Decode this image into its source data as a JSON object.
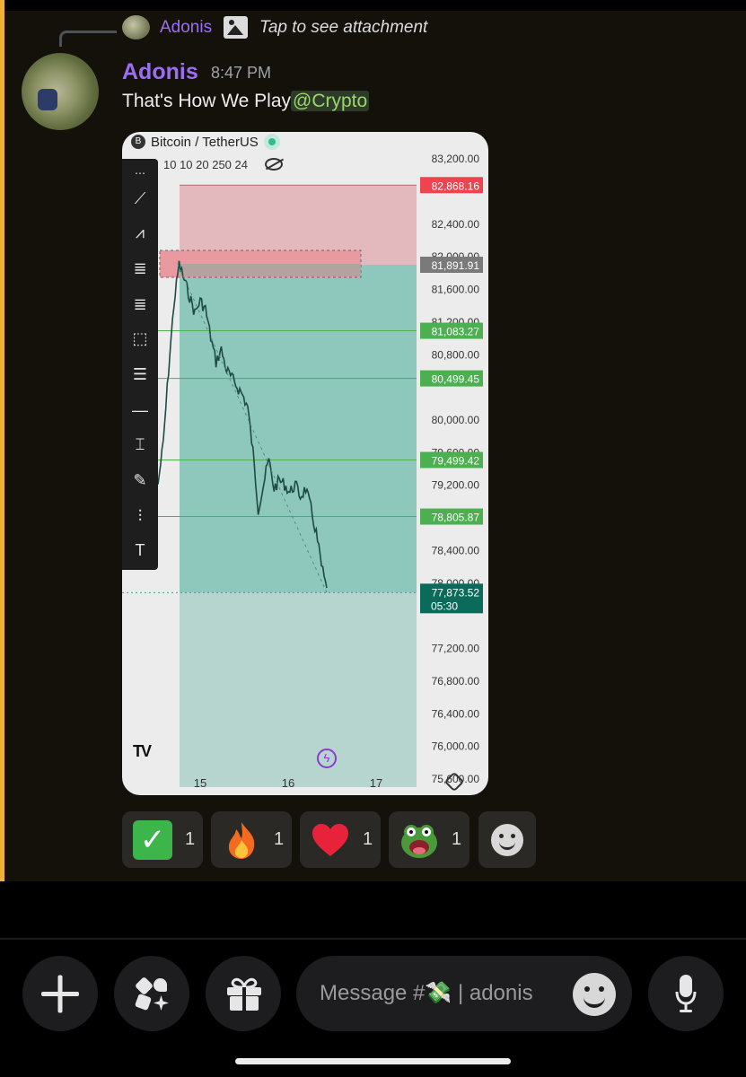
{
  "reply": {
    "name": "Adonis",
    "text": "Tap to see attachment"
  },
  "message": {
    "author": "Adonis",
    "time": "8:47 PM",
    "text": "That's How We Play",
    "mention": "@Crypto"
  },
  "chart": {
    "symbol": "Bitcoin / TetherUS",
    "symbol_badge": "B",
    "indicators": "10 10 20 250 24",
    "y_ticks": [
      "83,200.00",
      "82,400.00",
      "82,000.00",
      "81,600.00",
      "81,200.00",
      "80,800.00",
      "80,000.00",
      "79,600.00",
      "79,200.00",
      "78,400.00",
      "78,000.00",
      "77,200.00",
      "76,800.00",
      "76,400.00",
      "76,000.00",
      "75,600.00"
    ],
    "x_ticks": [
      "15",
      "16",
      "17"
    ],
    "price_labels": [
      {
        "value": "82,868.16",
        "color": "#f04350"
      },
      {
        "value": "81,891.91",
        "color": "#7a7a7a"
      },
      {
        "value": "81,083.27",
        "color": "#4caf50"
      },
      {
        "value": "80,499.45",
        "color": "#4caf50"
      },
      {
        "value": "79,499.42",
        "color": "#4caf50"
      },
      {
        "value": "78,805.87",
        "color": "#4caf50"
      }
    ],
    "current_price": "77,873.52",
    "countdown": "05:30",
    "logo": "TV"
  },
  "chart_data": {
    "type": "line",
    "title": "Bitcoin / TetherUS",
    "xlabel": "",
    "ylabel": "",
    "x_ticks": [
      "15",
      "16",
      "17"
    ],
    "ylim": [
      75600,
      83300
    ],
    "levels": {
      "stop_loss": 82868.16,
      "entry": 81891.91,
      "targets": [
        81083.27,
        80499.45,
        79499.42,
        78805.87
      ],
      "current": 77873.52
    },
    "series": [
      {
        "values": [
          79200,
          79700,
          80600,
          81400,
          81900,
          81700,
          81500,
          81300,
          81450,
          81350,
          81000,
          80700,
          80850,
          80600,
          80500,
          80400,
          80300,
          80150,
          79600,
          78900,
          79200,
          79500,
          79150,
          79250,
          79200,
          79100,
          79200,
          79050,
          79150,
          78900,
          78600,
          78200,
          77900
        ]
      }
    ]
  },
  "reactions": [
    {
      "emoji": "check",
      "count": "1"
    },
    {
      "emoji": "fire",
      "count": "1"
    },
    {
      "emoji": "heart",
      "count": "1"
    },
    {
      "emoji": "pepe",
      "count": "1"
    }
  ],
  "input": {
    "placeholder": "Message #💸 | adonis"
  }
}
